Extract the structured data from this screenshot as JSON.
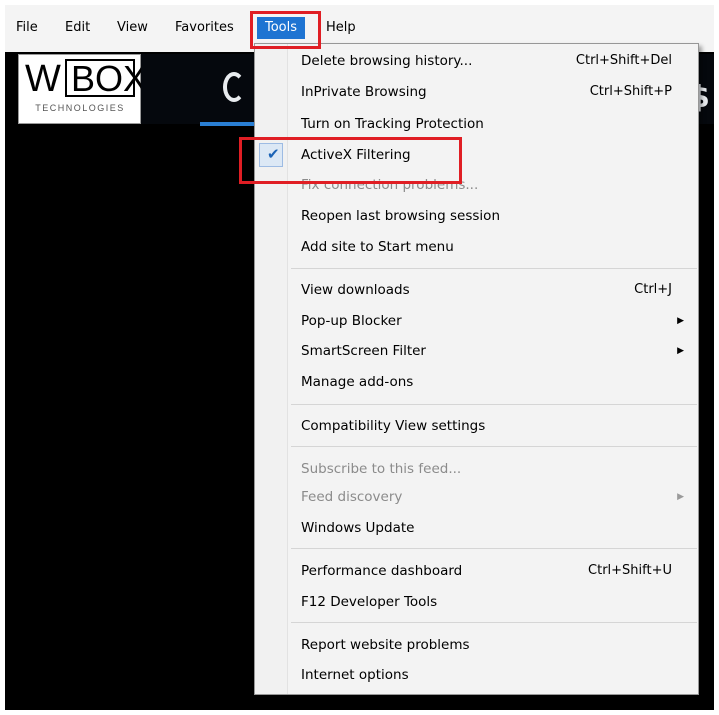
{
  "menubar": {
    "items": [
      "File",
      "Edit",
      "View",
      "Favorites",
      "Tools",
      "Help"
    ],
    "active": "Tools"
  },
  "page": {
    "logo_main": "BOX",
    "logo_w": "W",
    "logo_sub": "TECHNOLOGIES"
  },
  "tools_menu": {
    "groups": [
      [
        {
          "label": "Delete browsing history...",
          "shortcut": "Ctrl+Shift+Del",
          "enabled": true
        },
        {
          "label": "InPrivate Browsing",
          "shortcut": "Ctrl+Shift+P",
          "enabled": true
        },
        {
          "label": "Turn on Tracking Protection",
          "shortcut": "",
          "enabled": true
        },
        {
          "label": "ActiveX Filtering",
          "shortcut": "",
          "enabled": true,
          "checked": true
        },
        {
          "label": "Fix connection problems...",
          "shortcut": "",
          "enabled": false
        },
        {
          "label": "Reopen last browsing session",
          "shortcut": "",
          "enabled": true
        },
        {
          "label": "Add site to Start menu",
          "shortcut": "",
          "enabled": true
        }
      ],
      [
        {
          "label": "View downloads",
          "shortcut": "Ctrl+J",
          "enabled": true
        },
        {
          "label": "Pop-up Blocker",
          "shortcut": "",
          "enabled": true,
          "submenu": true
        },
        {
          "label": "SmartScreen Filter",
          "shortcut": "",
          "enabled": true,
          "submenu": true
        },
        {
          "label": "Manage add-ons",
          "shortcut": "",
          "enabled": true
        }
      ],
      [
        {
          "label": "Compatibility View settings",
          "shortcut": "",
          "enabled": true
        }
      ],
      [
        {
          "label": "Subscribe to this feed...",
          "shortcut": "",
          "enabled": false
        },
        {
          "label": "Feed discovery",
          "shortcut": "",
          "enabled": false,
          "submenu": true
        },
        {
          "label": "Windows Update",
          "shortcut": "",
          "enabled": true
        }
      ],
      [
        {
          "label": "Performance dashboard",
          "shortcut": "Ctrl+Shift+U",
          "enabled": true
        },
        {
          "label": "F12 Developer Tools",
          "shortcut": "",
          "enabled": true
        }
      ],
      [
        {
          "label": "Report website problems",
          "shortcut": "",
          "enabled": true
        },
        {
          "label": "Internet options",
          "shortcut": "",
          "enabled": true
        }
      ]
    ]
  },
  "colors": {
    "highlight_outline": "#e01e24",
    "active_menu_bg": "#1e74d2",
    "check_color": "#1b63b6",
    "disabled_text": "#8b8b8b"
  },
  "icons": {
    "check": "checkmark-icon",
    "submenu_arrow": "triangle-right-icon"
  }
}
